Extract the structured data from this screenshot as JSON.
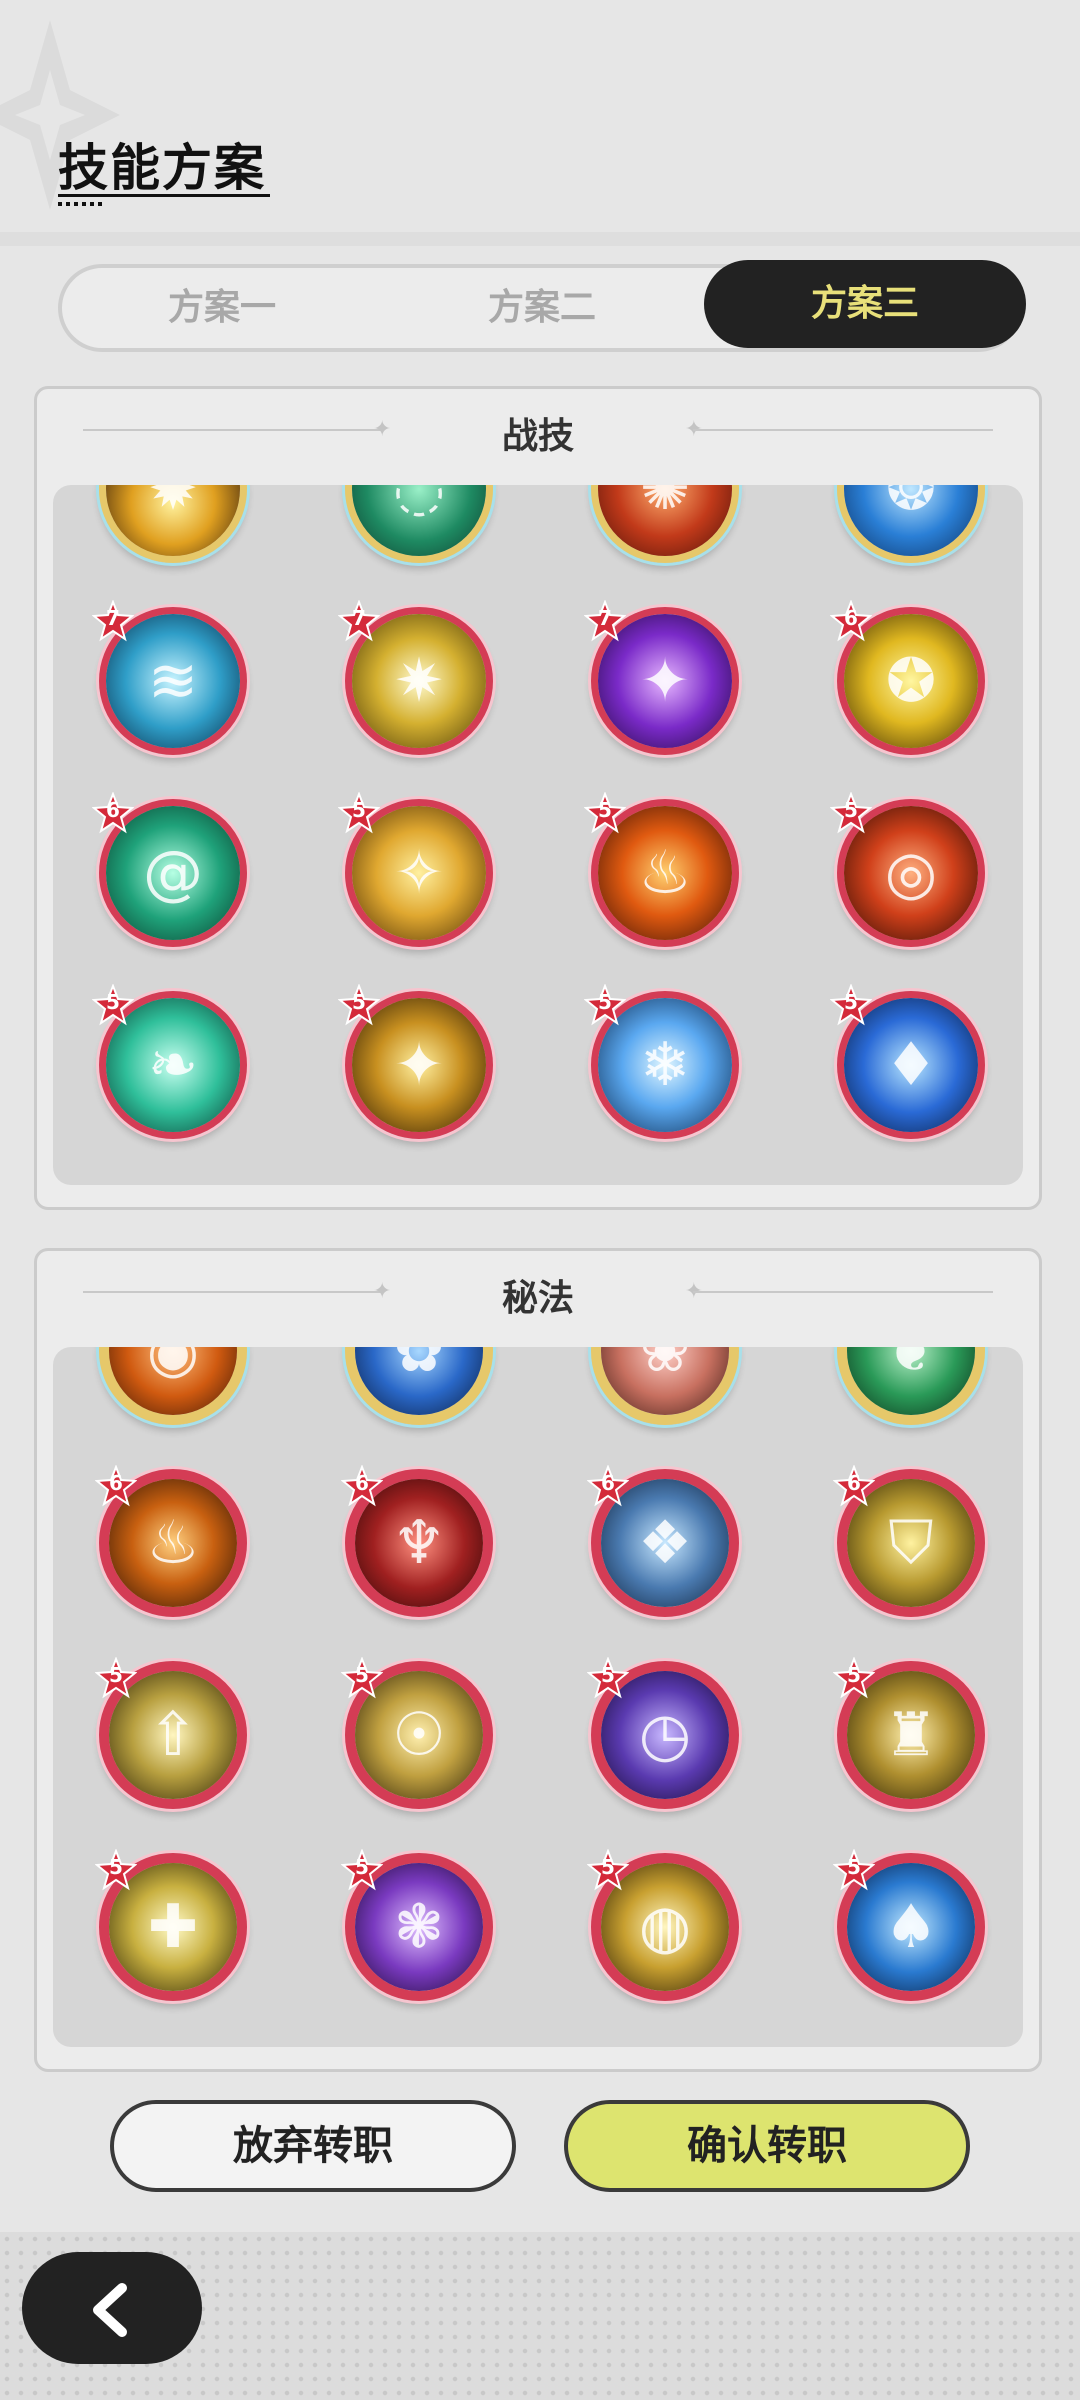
{
  "page": {
    "title": "技能方案"
  },
  "tabs": [
    {
      "label": "方案一"
    },
    {
      "label": "方案二"
    },
    {
      "label": "方案三",
      "active": true
    }
  ],
  "sections": [
    {
      "title": "战技",
      "rows": [
        [
          {
            "icon": "golden-burst-skill-icon",
            "level": ""
          },
          {
            "icon": "green-swirl-skill-icon",
            "level": ""
          },
          {
            "icon": "red-explosion-skill-icon",
            "level": ""
          },
          {
            "icon": "blue-water-splash-skill-icon",
            "level": ""
          }
        ],
        [
          {
            "icon": "wave-skill-icon",
            "level": "7"
          },
          {
            "icon": "light-burst-skill-icon",
            "level": "7"
          },
          {
            "icon": "purple-orb-skill-icon",
            "level": "7"
          },
          {
            "icon": "golden-fox-orb-skill-icon",
            "level": "6"
          }
        ],
        [
          {
            "icon": "green-whirlwind-skill-icon",
            "level": "6"
          },
          {
            "icon": "golden-star-shard-skill-icon",
            "level": "5"
          },
          {
            "icon": "flame-creature-skill-icon",
            "level": "5"
          },
          {
            "icon": "fire-vortex-skill-icon",
            "level": "5"
          }
        ],
        [
          {
            "icon": "teal-leaf-slash-skill-icon",
            "level": "5"
          },
          {
            "icon": "sparkle-stars-skill-icon",
            "level": "5"
          },
          {
            "icon": "ice-crystal-skill-icon",
            "level": "5"
          },
          {
            "icon": "blue-flame-skill-icon",
            "level": "5"
          }
        ]
      ]
    },
    {
      "title": "秘法",
      "rows": [
        [
          {
            "icon": "orange-spiral-arcana-icon",
            "level": ""
          },
          {
            "icon": "blue-flower-arcana-icon",
            "level": ""
          },
          {
            "icon": "pink-sigil-arcana-icon",
            "level": ""
          },
          {
            "icon": "green-leaf-arcana-icon",
            "level": ""
          }
        ],
        [
          {
            "icon": "fire-burst-arcana-icon",
            "level": "6"
          },
          {
            "icon": "red-demon-arcana-icon",
            "level": "6"
          },
          {
            "icon": "blue-crystal-arcana-icon",
            "level": "6"
          },
          {
            "icon": "gold-shield-arcana-icon",
            "level": "6"
          }
        ],
        [
          {
            "icon": "upward-arrow-arcana-icon",
            "level": "5"
          },
          {
            "icon": "golden-figure-arcana-icon",
            "level": "5"
          },
          {
            "icon": "purple-clock-arcana-icon",
            "level": "5"
          },
          {
            "icon": "golden-statue-arcana-icon",
            "level": "5"
          }
        ],
        [
          {
            "icon": "healing-figure-arcana-icon",
            "level": "5"
          },
          {
            "icon": "purple-swirl-arcana-icon",
            "level": "5"
          },
          {
            "icon": "golden-ring-arcana-icon",
            "level": "5"
          },
          {
            "icon": "blue-flame-figure-arcana-icon",
            "level": "5"
          }
        ]
      ]
    }
  ],
  "buttons": {
    "cancel": "放弃转职",
    "confirm": "确认转职"
  },
  "colors": {
    "accent": "#dde46f",
    "active_tab_bg": "#222222",
    "active_tab_text": "#e8e07a",
    "skill_border": "#d43c55"
  }
}
